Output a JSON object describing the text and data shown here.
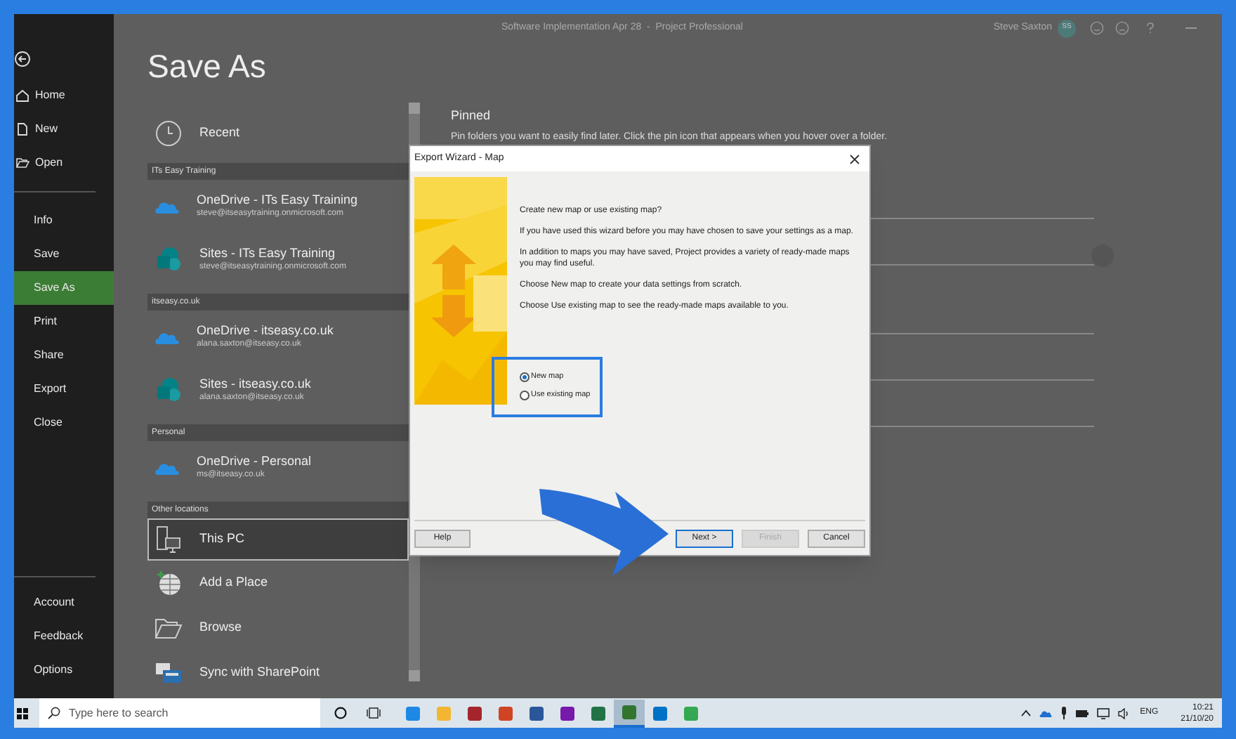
{
  "title_bar": {
    "title": "Software Implementation Apr 28  -  Project Professional",
    "user": "Steve Saxton",
    "initials": "SS"
  },
  "sidebar": {
    "top": [
      {
        "label": "Home",
        "kind": "home",
        "selected": false
      },
      {
        "label": "New",
        "kind": "new",
        "selected": false
      },
      {
        "label": "Open",
        "kind": "open",
        "selected": false
      }
    ],
    "middle": [
      {
        "label": "Info",
        "selected": false
      },
      {
        "label": "Save",
        "selected": false
      },
      {
        "label": "Save As",
        "selected": true
      },
      {
        "label": "Print",
        "selected": false
      },
      {
        "label": "Share",
        "selected": false
      },
      {
        "label": "Export",
        "selected": false
      },
      {
        "label": "Close",
        "selected": false
      }
    ],
    "bottom": [
      {
        "label": "Account",
        "selected": false
      },
      {
        "label": "Feedback",
        "selected": false
      },
      {
        "label": "Options",
        "selected": false
      }
    ]
  },
  "page_title": "Save As",
  "locations": [
    {
      "kind": "recent",
      "label": "Recent",
      "selected": false
    },
    {
      "kind": "header",
      "label": "ITs Easy Training"
    },
    {
      "kind": "onedrive",
      "label": "OneDrive - ITs Easy Training",
      "email": "steve@itseasytraining.onmicrosoft.com",
      "selected": false
    },
    {
      "kind": "sites",
      "label": "Sites - ITs Easy Training",
      "email": "steve@itseasytraining.onmicrosoft.com",
      "selected": false
    },
    {
      "kind": "header",
      "label": "itseasy.co.uk"
    },
    {
      "kind": "onedrive",
      "label": "OneDrive - itseasy.co.uk",
      "email": "alana.saxton@itseasy.co.uk",
      "selected": false
    },
    {
      "kind": "sites",
      "label": "Sites - itseasy.co.uk",
      "email": "alana.saxton@itseasy.co.uk",
      "selected": false
    },
    {
      "kind": "header",
      "label": "Personal"
    },
    {
      "kind": "onedrive",
      "label": "OneDrive - Personal",
      "email": "ms@itseasy.co.uk",
      "selected": false
    },
    {
      "kind": "header",
      "label": "Other locations"
    },
    {
      "kind": "this_pc",
      "label": "This PC",
      "selected": true
    },
    {
      "kind": "add_place",
      "label": "Add a Place",
      "selected": false
    },
    {
      "kind": "browse",
      "label": "Browse",
      "selected": false
    },
    {
      "kind": "sync",
      "label": "Sync with SharePoint",
      "selected": false
    }
  ],
  "pinned": {
    "heading": "Pinned",
    "description": "Pin folders you want to easily find later. Click the pin icon that appears when you hover over a folder."
  },
  "dialog": {
    "title": "Export Wizard - Map",
    "paragraphs": [
      "Create new map or use existing map?",
      "If you have used this wizard before you may have chosen to save your settings as a map.",
      "In addition to maps you may have saved, Project provides a variety of ready-made maps you may find useful.",
      "Choose New map to create your data settings from scratch.",
      "Choose Use existing map to see the ready-made maps available to you."
    ],
    "options": [
      {
        "label": "New map",
        "selected": true
      },
      {
        "label": "Use existing map",
        "selected": false
      }
    ],
    "buttons": [
      {
        "kind": "help",
        "label": "Help",
        "disabled": false,
        "focused": false
      },
      {
        "kind": "next",
        "label": "Next >",
        "disabled": false,
        "focused": true
      },
      {
        "kind": "finish",
        "label": "Finish",
        "disabled": true,
        "focused": false
      },
      {
        "kind": "cancel",
        "label": "Cancel",
        "disabled": false,
        "focused": false
      }
    ]
  },
  "taskbar": {
    "search": {
      "placeholder": "Type here to search"
    },
    "apps": [
      {
        "color": "#1e88e5",
        "active": false
      },
      {
        "color": "#f2b632",
        "active": false
      },
      {
        "color": "#a4262c",
        "active": false
      },
      {
        "color": "#d04423",
        "active": false
      },
      {
        "color": "#2b579a",
        "active": false
      },
      {
        "color": "#7719aa",
        "active": false
      },
      {
        "color": "#217346",
        "active": false
      },
      {
        "color": "#31752f",
        "active": true
      },
      {
        "color": "#0072c6",
        "active": false
      },
      {
        "color": "#34a853",
        "active": false
      }
    ],
    "language": "ENG",
    "time": "10:21",
    "date": "21/10/20"
  }
}
